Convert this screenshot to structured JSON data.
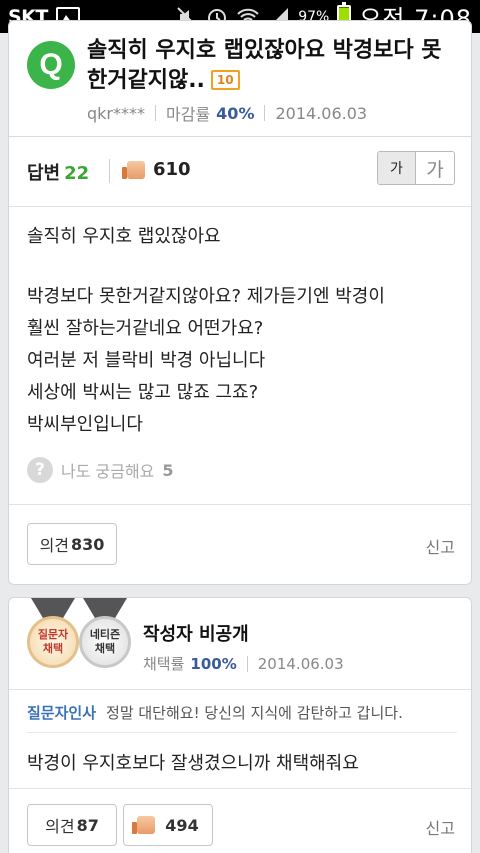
{
  "status_bar": {
    "carrier": "SKT",
    "battery": "97%",
    "time": "오전 7:08",
    "icons": [
      "image-icon",
      "mute-icon",
      "alarm-icon",
      "wifi-icon",
      "signal-icon",
      "battery-icon"
    ]
  },
  "question": {
    "badge": "Q",
    "title": "솔직히 우지호 랩있잖아요 박경보다 못한거같지않..",
    "points": "10",
    "author": "qkr****",
    "close_rate_label": "마감률",
    "close_rate_value": "40%",
    "date": "2014.06.03",
    "answers_label": "답변",
    "answers_count": "22",
    "likes_count": "610",
    "font_small_label": "가",
    "font_large_label": "가",
    "body_line1": "솔직히 우지호 랩있잖아요",
    "body_para2": "박경보다 못한거같지않아요? 제가듣기엔 박경이\n훨씬 잘하는거같네요 어떤가요?\n여러분 저 블락비 박경 아닙니다\n세상에 박씨는 많고 많죠 그죠?\n박씨부인입니다",
    "curious_label": "나도 궁금해요",
    "curious_count": "5",
    "opinion_label": "의견",
    "opinion_count": "830",
    "report_label": "신고"
  },
  "answer": {
    "medal_questioner": "질문자\n채택",
    "medal_netizen": "네티즌\n채택",
    "author": "작성자 비공개",
    "adopt_rate_label": "채택률",
    "adopt_rate_value": "100%",
    "date": "2014.06.03",
    "thanks_label": "질문자인사",
    "thanks_text": "정말 대단해요! 당신의 지식에 감탄하고 갑니다.",
    "body": "박경이 우지호보다 잘생겼으니까 채택해줘요",
    "opinion_label": "의견",
    "opinion_count": "87",
    "likes_count": "494",
    "report_label": "신고"
  },
  "colors": {
    "accent_green": "#3bb54a",
    "count_green": "#3aa635",
    "rate_blue": "#3a5b99",
    "thanks_blue": "#3a72b7",
    "points_orange": "#f1a21e"
  }
}
